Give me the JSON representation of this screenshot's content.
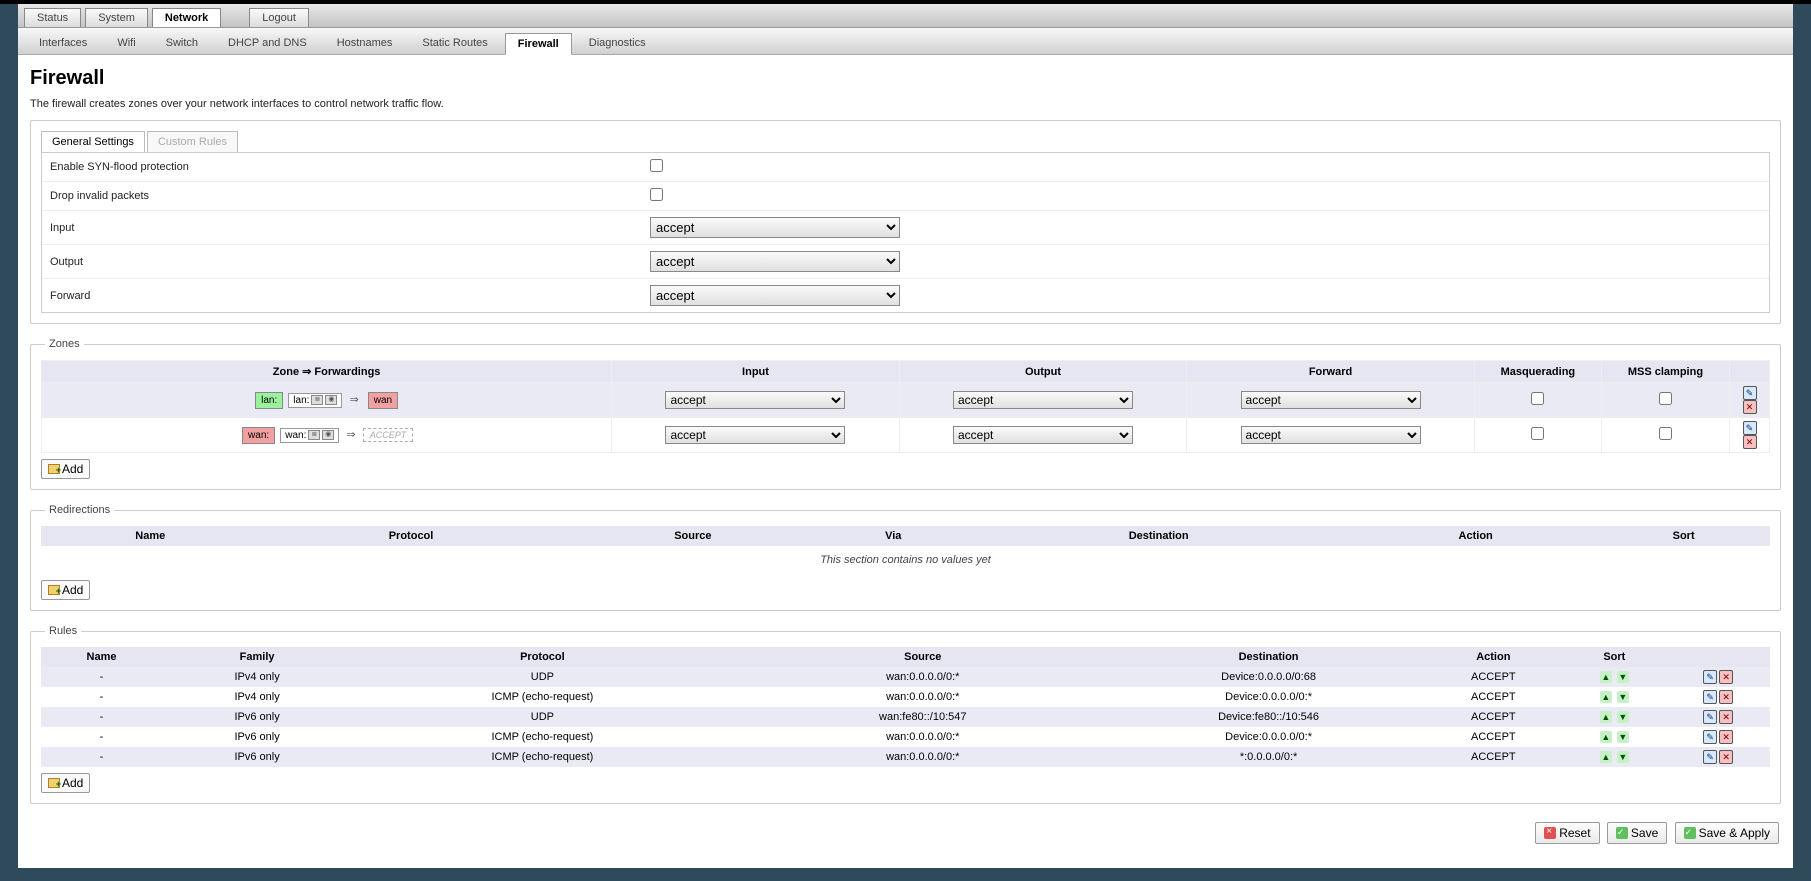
{
  "mainTabs": {
    "status": "Status",
    "system": "System",
    "network": "Network",
    "logout": "Logout"
  },
  "subTabs": {
    "interfaces": "Interfaces",
    "wifi": "Wifi",
    "switch": "Switch",
    "dhcp": "DHCP and DNS",
    "hostnames": "Hostnames",
    "staticroutes": "Static Routes",
    "firewall": "Firewall",
    "diagnostics": "Diagnostics"
  },
  "page": {
    "title": "Firewall",
    "description": "The firewall creates zones over your network interfaces to control network traffic flow."
  },
  "innerTabs": {
    "general": "General Settings",
    "custom": "Custom Rules"
  },
  "general": {
    "synflood_label": "Enable SYN-flood protection",
    "dropinvalid_label": "Drop invalid packets",
    "input_label": "Input",
    "output_label": "Output",
    "forward_label": "Forward",
    "input_value": "accept",
    "output_value": "accept",
    "forward_value": "accept"
  },
  "zonesLegend": "Zones",
  "zonesHeaders": {
    "zone": "Zone ⇒ Forwardings",
    "input": "Input",
    "output": "Output",
    "forward": "Forward",
    "masq": "Masquerading",
    "mss": "MSS clamping"
  },
  "zones": [
    {
      "name": "lan",
      "nameLabel": "lan:",
      "ifLabel": "lan:",
      "fwd": "wan",
      "fwdIsAccept": false,
      "input": "accept",
      "output": "accept",
      "forward": "accept",
      "masq": false,
      "mss": false
    },
    {
      "name": "wan",
      "nameLabel": "wan:",
      "ifLabel": "wan:",
      "fwd": "ACCEPT",
      "fwdIsAccept": true,
      "input": "accept",
      "output": "accept",
      "forward": "accept",
      "masq": false,
      "mss": false
    }
  ],
  "redirLegend": "Redirections",
  "redirHeaders": {
    "name": "Name",
    "protocol": "Protocol",
    "source": "Source",
    "via": "Via",
    "destination": "Destination",
    "action": "Action",
    "sort": "Sort"
  },
  "redirEmpty": "This section contains no values yet",
  "rulesLegend": "Rules",
  "rulesHeaders": {
    "name": "Name",
    "family": "Family",
    "protocol": "Protocol",
    "source": "Source",
    "destination": "Destination",
    "action": "Action",
    "sort": "Sort"
  },
  "rules": [
    {
      "name": "-",
      "family": "IPv4 only",
      "protocol": "UDP",
      "source": "wan:0.0.0.0/0:*",
      "destination": "Device:0.0.0.0/0:68",
      "action": "ACCEPT"
    },
    {
      "name": "-",
      "family": "IPv4 only",
      "protocol": "ICMP (echo-request)",
      "source": "wan:0.0.0.0/0:*",
      "destination": "Device:0.0.0.0/0:*",
      "action": "ACCEPT"
    },
    {
      "name": "-",
      "family": "IPv6 only",
      "protocol": "UDP",
      "source": "wan:fe80::/10:547",
      "destination": "Device:fe80::/10:546",
      "action": "ACCEPT"
    },
    {
      "name": "-",
      "family": "IPv6 only",
      "protocol": "ICMP (echo-request)",
      "source": "wan:0.0.0.0/0:*",
      "destination": "Device:0.0.0.0/0:*",
      "action": "ACCEPT"
    },
    {
      "name": "-",
      "family": "IPv6 only",
      "protocol": "ICMP (echo-request)",
      "source": "wan:0.0.0.0/0:*",
      "destination": "*:0.0.0.0/0:*",
      "action": "ACCEPT"
    }
  ],
  "addLabel": "Add",
  "footer": {
    "reset": "Reset",
    "save": "Save",
    "saveapply": "Save & Apply"
  }
}
